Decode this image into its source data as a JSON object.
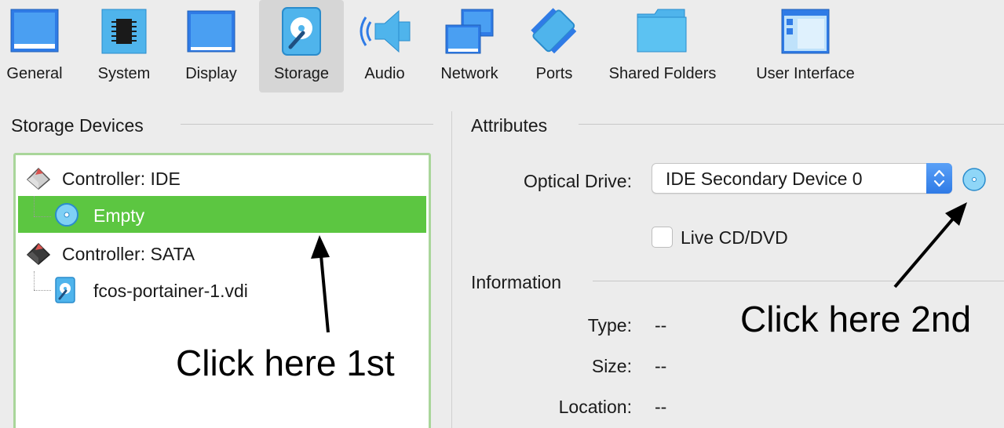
{
  "toolbar": {
    "items": [
      {
        "label": "General",
        "icon": "monitor-general-icon"
      },
      {
        "label": "System",
        "icon": "chip-icon"
      },
      {
        "label": "Display",
        "icon": "monitor-icon"
      },
      {
        "label": "Storage",
        "icon": "hard-disk-icon",
        "selected": true
      },
      {
        "label": "Audio",
        "icon": "speaker-icon"
      },
      {
        "label": "Network",
        "icon": "network-monitors-icon"
      },
      {
        "label": "Ports",
        "icon": "port-connector-icon"
      },
      {
        "label": "Shared Folders",
        "icon": "folder-icon"
      },
      {
        "label": "User Interface",
        "icon": "window-layout-icon"
      }
    ]
  },
  "storage_devices": {
    "title": "Storage Devices",
    "tree": [
      {
        "label": "Controller: IDE",
        "type": "controller",
        "icon": "ide-controller-icon"
      },
      {
        "label": "Empty",
        "type": "optical",
        "icon": "optical-disc-icon",
        "selected": true
      },
      {
        "label": "Controller: SATA",
        "type": "controller",
        "icon": "sata-controller-icon"
      },
      {
        "label": "fcos-portainer-1.vdi",
        "type": "disk",
        "icon": "hard-disk-icon"
      }
    ]
  },
  "attributes": {
    "title": "Attributes",
    "optical_drive_label": "Optical Drive:",
    "optical_drive_value": "IDE Secondary Device 0",
    "live_cd_label": "Live CD/DVD",
    "live_cd_checked": false
  },
  "information": {
    "title": "Information",
    "type_label": "Type:",
    "type_value": "--",
    "size_label": "Size:",
    "size_value": "--",
    "location_label": "Location:",
    "location_value": "--"
  },
  "annotations": {
    "first": "Click here 1st",
    "second": "Click here 2nd"
  },
  "colors": {
    "selection_green": "#5cc641",
    "tree_border": "#a9d69a",
    "accent_blue": "#2f7be6",
    "icon_blue": "#4fb4ec"
  }
}
